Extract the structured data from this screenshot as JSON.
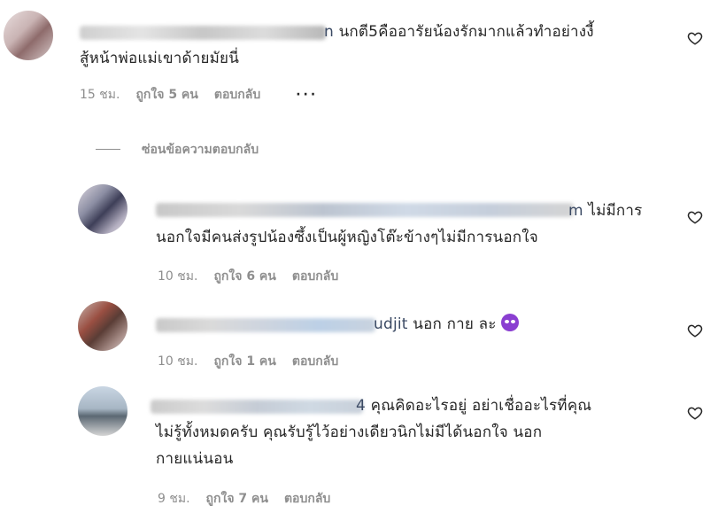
{
  "comments": [
    {
      "username_visible": "n",
      "text_line1": "นกตี5คืออารัยน้องรักมากแล้วทำอย่างงี้",
      "text_line2": "สู้หน้าพ่อแม่เขาด้ายมัยนี่",
      "time": "15 ชม.",
      "likes": "ถูกใจ 5 คน",
      "reply": "ตอบกลับ",
      "more": "···"
    },
    {
      "username_visible": "m",
      "text_line1": "ไม่มีการ",
      "text_line2": "นอกใจมีคนส่งรูปน้องซึ้งเป็นผู้หญิงโต๊ะข้างๆไม่มีการนอกใจ",
      "time": "10 ชม.",
      "likes": "ถูกใจ 6 คน",
      "reply": "ตอบกลับ"
    },
    {
      "username_visible": "udjit",
      "text_line1": "นอก กาย ละ",
      "time": "10 ชม.",
      "likes": "ถูกใจ 1 คน",
      "reply": "ตอบกลับ"
    },
    {
      "username_visible": "4",
      "text_line1": "คุณคิดอะไรอยู่ อย่าเชื่ออะไรที่คุณ",
      "text_line2": "ไม่รู้ทั้งหมดครับ คุณรับรู้ไว้อย่างเดียวนิกไม่มีได้นอกใจ นอก",
      "text_line3": "กายแน่นอน",
      "time": "9 ชม.",
      "likes": "ถูกใจ 7 คน",
      "reply": "ตอบกลับ"
    }
  ],
  "hide_replies": "ซ่อนข้อความตอบกลับ"
}
